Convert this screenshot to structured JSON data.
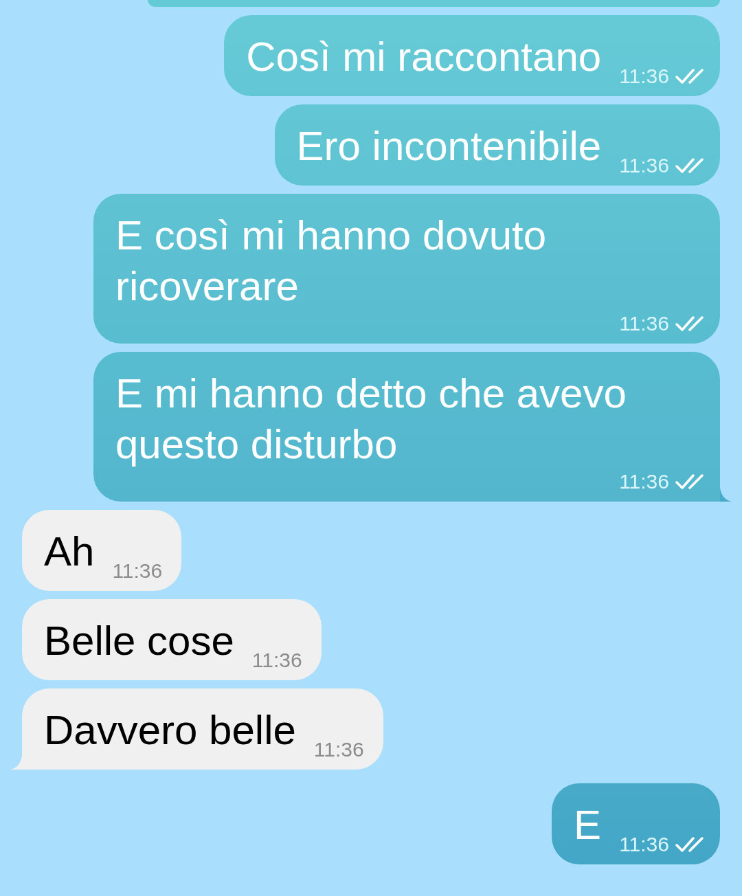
{
  "messages": [
    {
      "kind": "outgoing",
      "text": "Così mi raccontano",
      "time": "11:36",
      "read": true,
      "tail": false
    },
    {
      "kind": "outgoing",
      "text": "Ero incontenibile",
      "time": "11:36",
      "read": true,
      "tail": false
    },
    {
      "kind": "outgoing",
      "text": "E così mi hanno dovuto ricoverare",
      "time": "11:36",
      "read": true,
      "tail": false
    },
    {
      "kind": "outgoing",
      "text": "E mi hanno detto che avevo questo disturbo",
      "time": "11:36",
      "read": true,
      "tail": true
    },
    {
      "kind": "incoming",
      "text": "Ah",
      "time": "11:36",
      "tail": false
    },
    {
      "kind": "incoming",
      "text": "Belle cose",
      "time": "11:36",
      "tail": false
    },
    {
      "kind": "incoming",
      "text": "Davvero belle",
      "time": "11:36",
      "tail": true
    },
    {
      "kind": "outgoing",
      "text": "E",
      "time": "11:36",
      "read": true,
      "tail": false
    }
  ]
}
